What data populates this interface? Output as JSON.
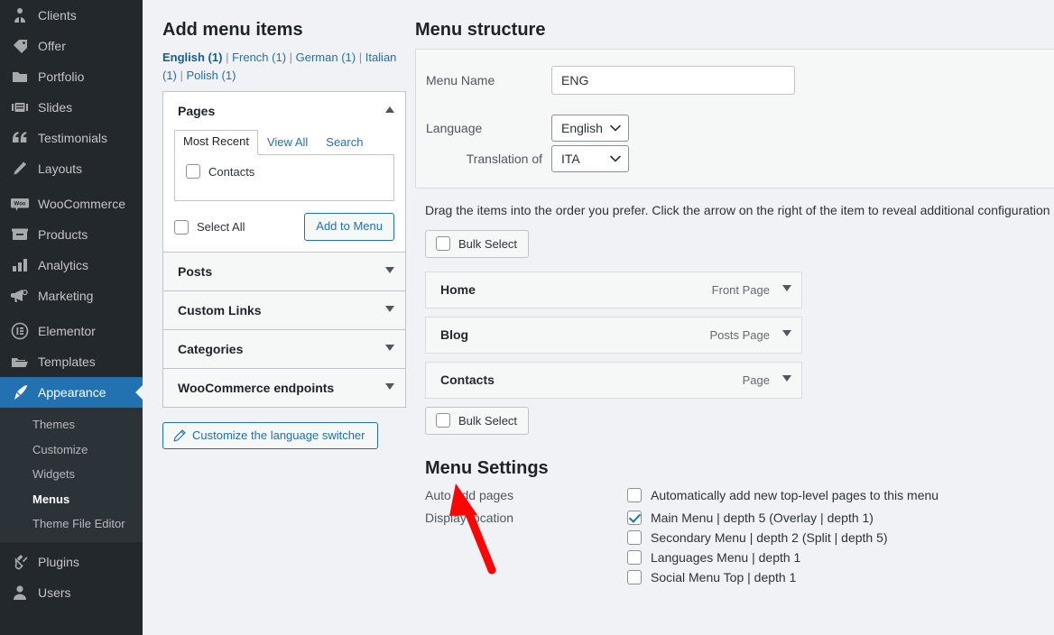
{
  "sidebar": {
    "items": [
      {
        "label": "Clients",
        "icon": "user-business-icon",
        "current": false
      },
      {
        "label": "Offer",
        "icon": "tag-icon",
        "current": false
      },
      {
        "label": "Portfolio",
        "icon": "folder-icon",
        "current": false
      },
      {
        "label": "Slides",
        "icon": "slides-icon",
        "current": false
      },
      {
        "label": "Testimonials",
        "icon": "quote-icon",
        "current": false
      },
      {
        "label": "Layouts",
        "icon": "pencil-icon",
        "current": false
      },
      {
        "label": "WooCommerce",
        "icon": "woocommerce-icon",
        "current": false
      },
      {
        "label": "Products",
        "icon": "products-box-icon",
        "current": false
      },
      {
        "label": "Analytics",
        "icon": "bar-chart-icon",
        "current": false
      },
      {
        "label": "Marketing",
        "icon": "megaphone-icon",
        "current": false
      },
      {
        "label": "Elementor",
        "icon": "elementor-icon",
        "current": false
      },
      {
        "label": "Templates",
        "icon": "templates-folder-icon",
        "current": false
      },
      {
        "label": "Appearance",
        "icon": "paintbrush-icon",
        "current": true
      },
      {
        "label": "Plugins",
        "icon": "plug-icon",
        "current": false
      },
      {
        "label": "Users",
        "icon": "user-icon",
        "current": false
      }
    ],
    "appearance_submenu": [
      {
        "label": "Themes",
        "current": false
      },
      {
        "label": "Customize",
        "current": false
      },
      {
        "label": "Widgets",
        "current": false
      },
      {
        "label": "Menus",
        "current": true
      },
      {
        "label": "Theme File Editor",
        "current": false
      }
    ]
  },
  "add_menu_items": {
    "title": "Add menu items",
    "language_links": [
      {
        "label": "English (1)",
        "current": true
      },
      {
        "label": "French (1)",
        "current": false
      },
      {
        "label": "German (1)",
        "current": false
      },
      {
        "label": "Italian (1)",
        "current": false
      },
      {
        "label": "Polish (1)",
        "current": false
      }
    ],
    "separator": "|",
    "pages_panel": {
      "title": "Pages",
      "arrow": "chevron-up-icon",
      "tabs": [
        {
          "label": "Most Recent",
          "active": true
        },
        {
          "label": "View All",
          "active": false
        },
        {
          "label": "Search",
          "active": false
        }
      ],
      "items": [
        {
          "label": "Contacts",
          "checked": false
        }
      ],
      "select_all_label": "Select All",
      "select_all_checked": false,
      "add_button_label": "Add to Menu"
    },
    "collapsed_panels": [
      {
        "title": "Posts",
        "arrow": "chevron-down-icon"
      },
      {
        "title": "Custom Links",
        "arrow": "chevron-down-icon"
      },
      {
        "title": "Categories",
        "arrow": "chevron-down-icon"
      },
      {
        "title": "WooCommerce endpoints",
        "arrow": "chevron-down-icon"
      }
    ],
    "customize_switcher_label": "Customize the language switcher"
  },
  "menu_structure": {
    "title": "Menu structure",
    "menu_name_label": "Menu Name",
    "menu_name_value": "ENG",
    "language_label": "Language",
    "language_value": "English",
    "translation_of_label": "Translation of",
    "translation_of_value": "ITA",
    "drag_help": "Drag the items into the order you prefer. Click the arrow on the right of the item to reveal additional configuration options.",
    "bulk_select_label": "Bulk Select",
    "bulk_select_checked": false,
    "items": [
      {
        "title": "Home",
        "type": "Front Page",
        "toggle": "chevron-down-icon"
      },
      {
        "title": "Blog",
        "type": "Posts Page",
        "toggle": "chevron-down-icon"
      },
      {
        "title": "Contacts",
        "type": "Page",
        "toggle": "chevron-down-icon"
      }
    ],
    "bulk_select_bottom_label": "Bulk Select",
    "bulk_select_bottom_checked": false
  },
  "menu_settings": {
    "title": "Menu Settings",
    "auto_add_label": "Auto add pages",
    "auto_add_option": "Automatically add new top-level pages to this menu",
    "auto_add_checked": false,
    "display_location_label": "Display location",
    "locations": [
      {
        "label": "Main Menu | depth 5 (Overlay | depth 1)",
        "checked": true
      },
      {
        "label": "Secondary Menu | depth 2 (Split | depth 5)",
        "checked": false
      },
      {
        "label": "Languages Menu | depth 1",
        "checked": false
      },
      {
        "label": "Social Menu Top | depth 1",
        "checked": false
      }
    ]
  },
  "annotation": {
    "arrow_color": "#fb0505",
    "name": "red-pointer-arrow"
  },
  "colors": {
    "sidebar_bg": "#23282d",
    "submenu_bg": "#2c3338",
    "accent_blue": "#2271b1",
    "page_bg": "#f0f2f5"
  }
}
